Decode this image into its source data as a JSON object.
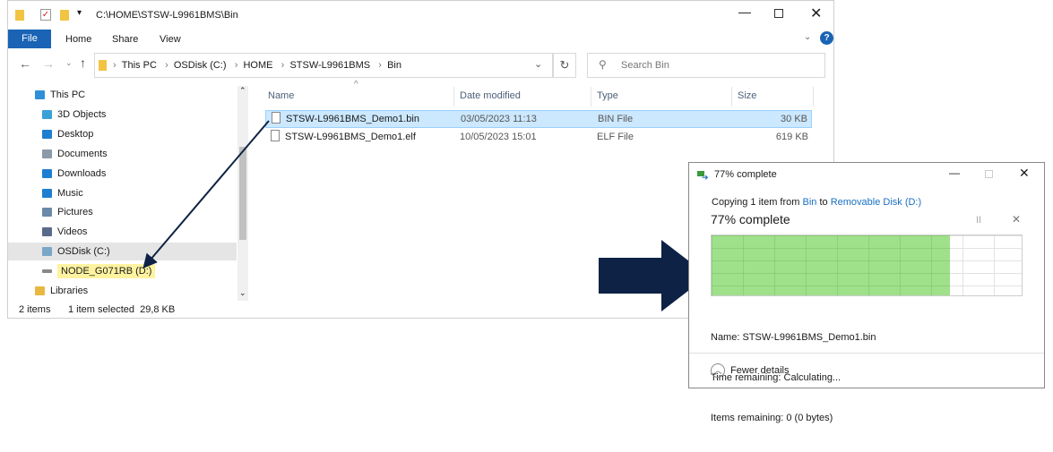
{
  "explorer": {
    "title": "C:\\HOME\\STSW-L9961BMS\\Bin",
    "ribbon_tabs": [
      "File",
      "Home",
      "Share",
      "View"
    ],
    "breadcrumb": [
      "This PC",
      "OSDisk (C:)",
      "HOME",
      "STSW-L9961BMS",
      "Bin"
    ],
    "search_placeholder": "Search Bin",
    "nav_items": [
      {
        "label": "This PC",
        "icon": "pc-icon",
        "color": "#2f8fd8"
      },
      {
        "label": "3D Objects",
        "icon": "cube-icon",
        "color": "#3aa0d8"
      },
      {
        "label": "Desktop",
        "icon": "desktop-icon",
        "color": "#1e7fd0"
      },
      {
        "label": "Documents",
        "icon": "documents-icon",
        "color": "#8a9aa8"
      },
      {
        "label": "Downloads",
        "icon": "download-icon",
        "color": "#1e7fd0"
      },
      {
        "label": "Music",
        "icon": "music-icon",
        "color": "#1e7fd0"
      },
      {
        "label": "Pictures",
        "icon": "pictures-icon",
        "color": "#6a8aa8"
      },
      {
        "label": "Videos",
        "icon": "videos-icon",
        "color": "#5a6a8a"
      },
      {
        "label": "OSDisk (C:)",
        "icon": "drive-icon",
        "color": "#7aa6c8"
      },
      {
        "label": "NODE_G071RB (D:)",
        "icon": "usb-drive-icon",
        "color": "#888888"
      },
      {
        "label": "Libraries",
        "icon": "libraries-icon",
        "color": "#e8b840"
      }
    ],
    "columns": [
      "Name",
      "Date modified",
      "Type",
      "Size"
    ],
    "files": [
      {
        "name": "STSW-L9961BMS_Demo1.bin",
        "date": "03/05/2023 11:13",
        "type": "BIN File",
        "size": "30 KB"
      },
      {
        "name": "STSW-L9961BMS_Demo1.elf",
        "date": "10/05/2023 15:01",
        "type": "ELF File",
        "size": "619 KB"
      }
    ],
    "status": {
      "items": "2 items",
      "selected": "1 item selected  29,8 KB"
    }
  },
  "dialog": {
    "title": "77% complete",
    "copying_prefix": "Copying 1 item from ",
    "source": "Bin",
    "to": " to ",
    "destination": "Removable Disk (D:)",
    "heading": "77% complete",
    "progress_percent": 77,
    "name_label": "Name:",
    "name_value": "STSW-L9961BMS_Demo1.bin",
    "time_label": "Time remaining:",
    "time_value": "Calculating...",
    "items_label": "Items remaining:",
    "items_value": "0 (0 bytes)",
    "fewer_details": "Fewer details"
  },
  "colors": {
    "accent": "#0063b1",
    "arrow": "#0d2244",
    "progress": "#9fe08a",
    "selected_row": "#cce8ff",
    "highlight": "#fff3a0"
  }
}
